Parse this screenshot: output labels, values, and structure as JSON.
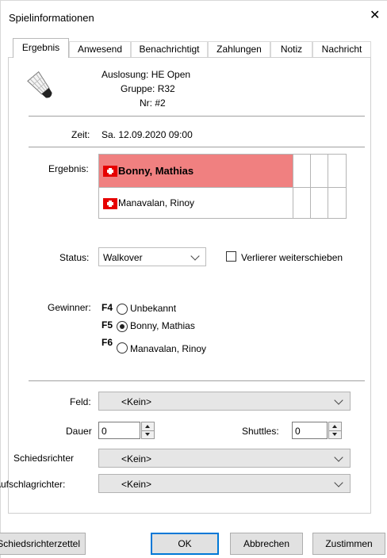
{
  "window": {
    "title": "Spielinformationen",
    "close_glyph": "✕"
  },
  "tabs": [
    {
      "label": "Ergebnis",
      "active": true
    },
    {
      "label": "Anwesend"
    },
    {
      "label": "Benachrichtigt"
    },
    {
      "label": "Zahlungen"
    },
    {
      "label": "Notiz"
    },
    {
      "label": "Nachricht"
    }
  ],
  "match": {
    "icon": "shuttlecock-icon",
    "auslosung": "Auslosung: HE Open",
    "gruppe": "Gruppe: R32",
    "nr": "Nr: #2",
    "zeit_label": "Zeit:",
    "zeit_value": "Sa. 12.09.2020 09:00"
  },
  "ergebnis": {
    "label": "Ergebnis:",
    "player1": {
      "name": "Bonny, Mathias",
      "flag": "switzerland-flag",
      "highlight": "#f08080"
    },
    "player2": {
      "name": "Manavalan, Rinoy",
      "flag": "switzerland-flag"
    }
  },
  "status": {
    "label": "Status:",
    "value": "Walkover",
    "checkbox_label": "Verlierer weiterschieben",
    "checkbox_checked": false
  },
  "gewinner": {
    "label": "Gewinner:",
    "options": [
      {
        "key": "F4",
        "label": "Unbekannt",
        "selected": false
      },
      {
        "key": "F5",
        "label": "Bonny, Mathias",
        "selected": true
      },
      {
        "key": "F6",
        "label": "Manavalan, Rinoy",
        "selected": false
      }
    ]
  },
  "feld": {
    "label": "Feld:",
    "value": "<Kein>"
  },
  "dauer": {
    "label": "Dauer",
    "value": "0"
  },
  "shuttles": {
    "label": "Shuttles:",
    "value": "0"
  },
  "schiedsrichter": {
    "label": "Schiedsrichter",
    "value": "<Kein>"
  },
  "aufschlagrichter": {
    "label": "Aufschlagrichter:",
    "value": "<Kein>"
  },
  "buttons": {
    "schiedsrichterzettel": "Schiedsrichterzettel",
    "ok": "OK",
    "abbrechen": "Abbrechen",
    "zustimmen": "Zustimmen"
  }
}
